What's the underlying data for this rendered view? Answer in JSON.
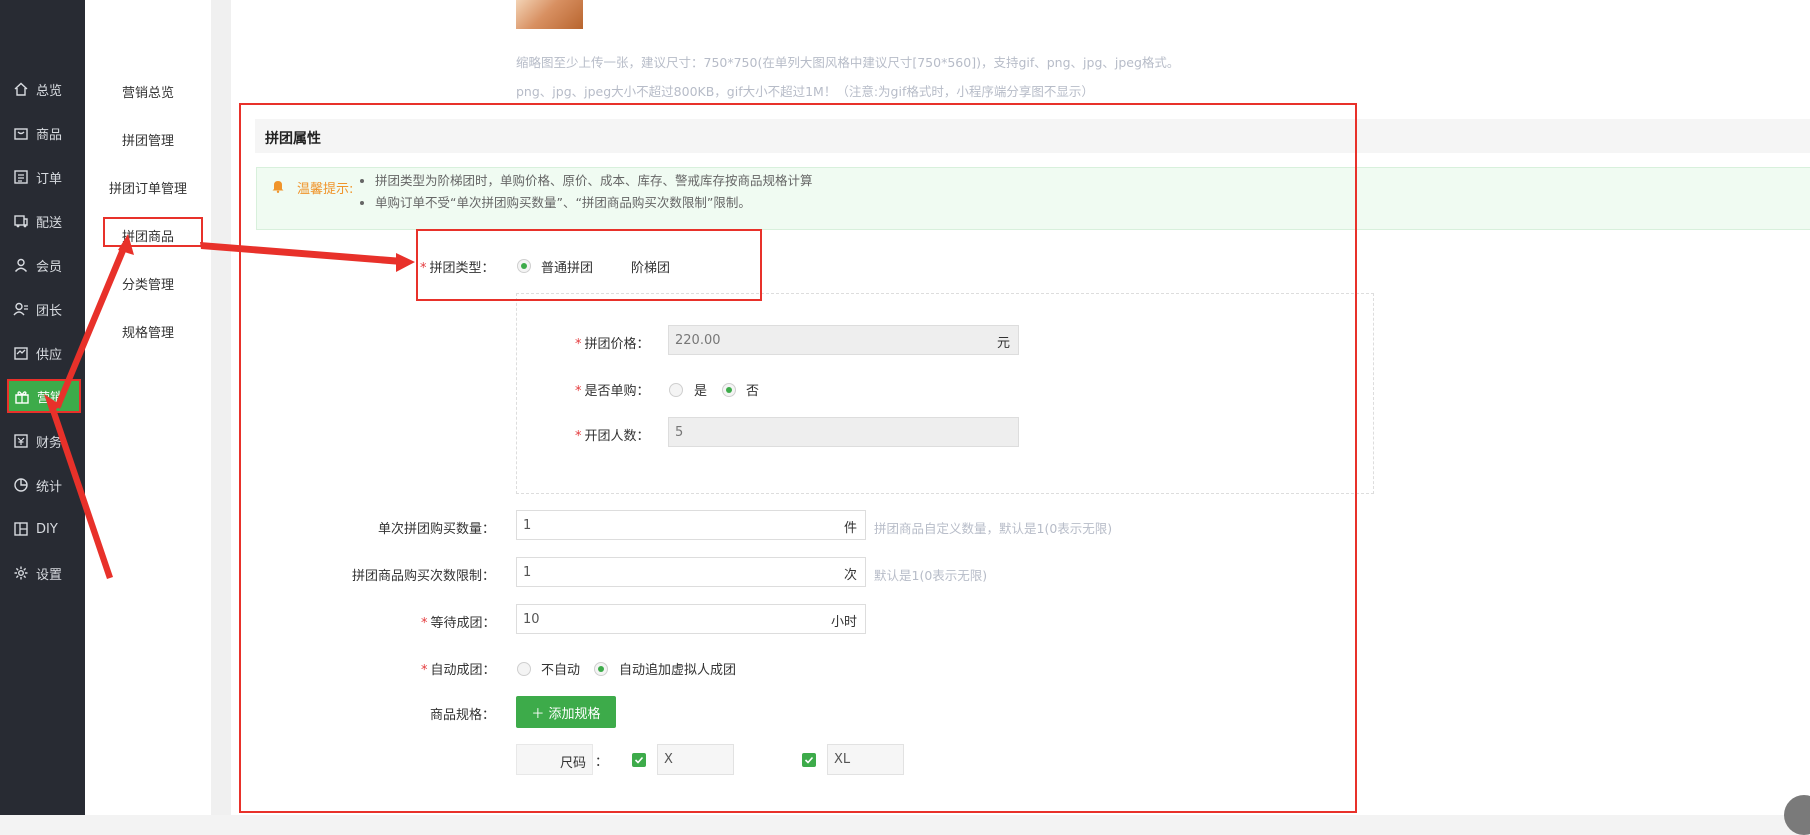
{
  "nav": {
    "items": [
      {
        "label": "总览",
        "icon": "home-icon"
      },
      {
        "label": "商品",
        "icon": "goods-icon"
      },
      {
        "label": "订单",
        "icon": "order-icon"
      },
      {
        "label": "配送",
        "icon": "delivery-icon"
      },
      {
        "label": "会员",
        "icon": "member-icon"
      },
      {
        "label": "团长",
        "icon": "leader-icon"
      },
      {
        "label": "供应",
        "icon": "supply-icon"
      },
      {
        "label": "营销",
        "icon": "gift-icon",
        "active": true
      },
      {
        "label": "财务",
        "icon": "finance-icon"
      },
      {
        "label": "统计",
        "icon": "pie-chart-icon"
      },
      {
        "label": "DIY",
        "icon": "layout-icon"
      },
      {
        "label": "设置",
        "icon": "gear-icon"
      }
    ]
  },
  "submenu": {
    "items": [
      {
        "label": "营销总览"
      },
      {
        "label": "拼团管理"
      },
      {
        "label": "拼团订单管理"
      },
      {
        "label": "拼团商品",
        "active": true
      },
      {
        "label": "分类管理"
      },
      {
        "label": "规格管理"
      }
    ]
  },
  "image_hint": {
    "line1": "缩略图至少上传一张，建议尺寸：750*750(在单列大图风格中建议尺寸[750*560])，支持gif、png、jpg、jpeg格式。",
    "line2": "png、jpg、jpeg大小不超过800KB，gif大小不超过1M！（注意:为gif格式时，小程序端分享图不显示）"
  },
  "section": {
    "title": "拼团属性"
  },
  "notice": {
    "title": "温馨提示:",
    "items": [
      "拼团类型为阶梯团时，单购价格、原价、成本、库存、警戒库存按商品规格计算",
      "单购订单不受“单次拼团购买数量”、“拼团商品购买次数限制”限制。"
    ]
  },
  "form": {
    "group_type": {
      "label": "拼团类型：",
      "options": [
        "普通拼团",
        "阶梯团"
      ],
      "selected": "普通拼团"
    },
    "group_price": {
      "label": "拼团价格：",
      "value": "220.00",
      "unit": "元"
    },
    "single_buy": {
      "label": "是否单购：",
      "options": [
        "是",
        "否"
      ],
      "selected": "否"
    },
    "group_size": {
      "label": "开团人数：",
      "value": "5"
    },
    "per_order_qty": {
      "label": "单次拼团购买数量：",
      "value": "1",
      "unit": "件",
      "hint": "拼团商品自定义数量，默认是1(0表示无限)"
    },
    "purchase_limit": {
      "label": "拼团商品购买次数限制：",
      "value": "1",
      "unit": "次",
      "hint": "默认是1(0表示无限)"
    },
    "wait_time": {
      "label": "等待成团：",
      "value": "10",
      "unit": "小时"
    },
    "auto_group": {
      "label": "自动成团：",
      "options": [
        "不自动",
        "自动追加虚拟人成团"
      ],
      "selected": "自动追加虚拟人成团"
    },
    "specs": {
      "label": "商品规格：",
      "add_button": "＋ 添加规格",
      "spec_name": "尺码",
      "colon": "：",
      "values": [
        "X",
        "XL"
      ]
    }
  },
  "colors": {
    "accent": "#3dab4a",
    "annotation": "#e8312a",
    "nav_bg": "#282b33",
    "required": "#e4393c"
  }
}
